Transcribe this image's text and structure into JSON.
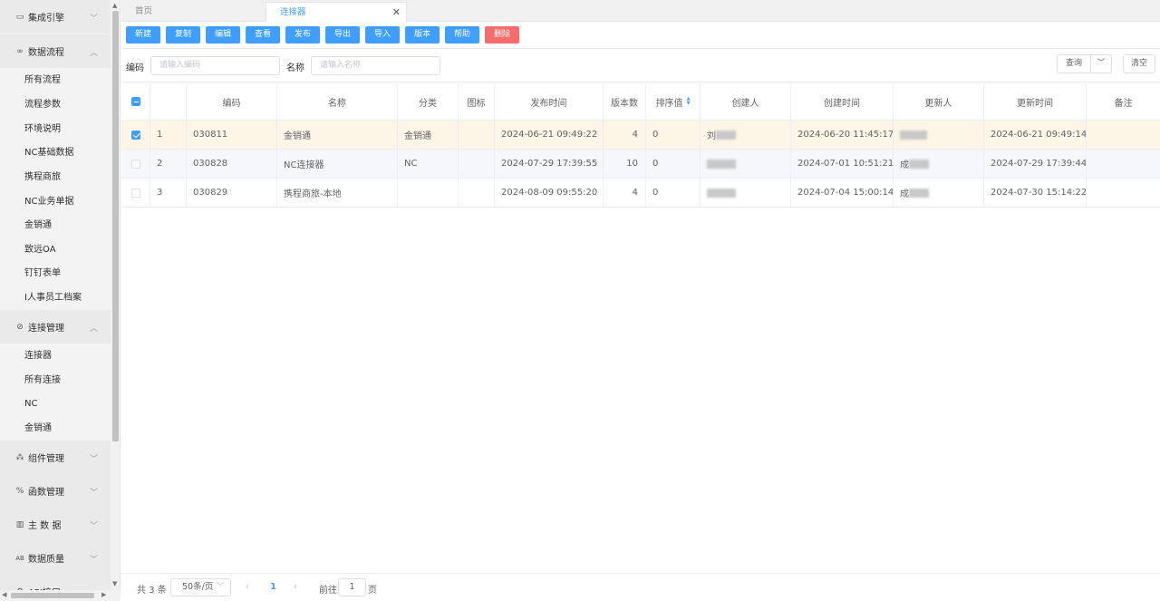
{
  "sidebar": {
    "groups": [
      {
        "label": "集成引擎",
        "icon": "monitor-icon"
      },
      {
        "label": "数据流程",
        "icon": "infinity-icon"
      },
      {
        "label": "连接管理",
        "icon": "link-icon"
      },
      {
        "label": "组件管理",
        "icon": "components-icon"
      },
      {
        "label": "函数管理",
        "icon": "percent-icon"
      },
      {
        "label": "主 数 据",
        "icon": "map-icon"
      },
      {
        "label": "数据质量",
        "icon": "ab-icon"
      },
      {
        "label": "API接口",
        "icon": "api-icon"
      }
    ],
    "flow_items": [
      "所有流程",
      "流程参数",
      "环境说明",
      "NC基础数据",
      "携程商旅",
      "NC业务单据",
      "金销通",
      "致远OA",
      "钉钉表单",
      "I人事员工档案"
    ],
    "conn_items": [
      "连接器",
      "所有连接",
      "NC",
      "金销通"
    ]
  },
  "tabs": [
    {
      "label": "首页",
      "active": false
    },
    {
      "label": "连接器",
      "active": true
    }
  ],
  "toolbar": {
    "buttons": [
      "新建",
      "复制",
      "编辑",
      "查看",
      "发布",
      "导出",
      "导入",
      "版本",
      "帮助"
    ],
    "delete": "删除"
  },
  "filter": {
    "code_label": "编码",
    "code_placeholder": "请输入编码",
    "name_label": "名称",
    "name_placeholder": "请输入名称",
    "query": "查询",
    "clear": "清空"
  },
  "table": {
    "headers": {
      "code": "编码",
      "name": "名称",
      "category": "分类",
      "icon": "图标",
      "publish_time": "发布时间",
      "versions": "版本数",
      "sort": "排序值",
      "creator": "创建人",
      "create_time": "创建时间",
      "updater": "更新人",
      "update_time": "更新时间",
      "remark": "备注"
    },
    "rows": [
      {
        "index": "1",
        "checked": true,
        "code": "030811",
        "name": "金销通",
        "category": "金销通",
        "publish_time": "2024-06-21 09:49:22",
        "versions": "4",
        "sort": "0",
        "creator": "刘",
        "create_time": "2024-06-20 11:45:17",
        "updater": "",
        "update_time": "2024-06-21 09:49:14"
      },
      {
        "index": "2",
        "checked": false,
        "code": "030828",
        "name": "NC连接器",
        "category": "NC",
        "publish_time": "2024-07-29 17:39:55",
        "versions": "10",
        "sort": "0",
        "creator": "",
        "create_time": "2024-07-01 10:51:21",
        "updater": "成",
        "update_time": "2024-07-29 17:39:44"
      },
      {
        "index": "3",
        "checked": false,
        "code": "030829",
        "name": "携程商旅-本地",
        "category": "",
        "publish_time": "2024-08-09 09:55:20",
        "versions": "4",
        "sort": "0",
        "creator": "",
        "create_time": "2024-07-04 15:00:14",
        "updater": "成",
        "update_time": "2024-07-30 15:14:22"
      }
    ]
  },
  "pager": {
    "total": "共 3 条",
    "page_size": "50条/页",
    "current_page": "1",
    "goto_label": "前往",
    "goto_value": "1",
    "page_suffix": "页"
  },
  "colors": {
    "primary": "#409eff",
    "danger": "#f56c6c",
    "selected_row": "#fdf5e6",
    "stripe_row": "#f5f7fa"
  }
}
